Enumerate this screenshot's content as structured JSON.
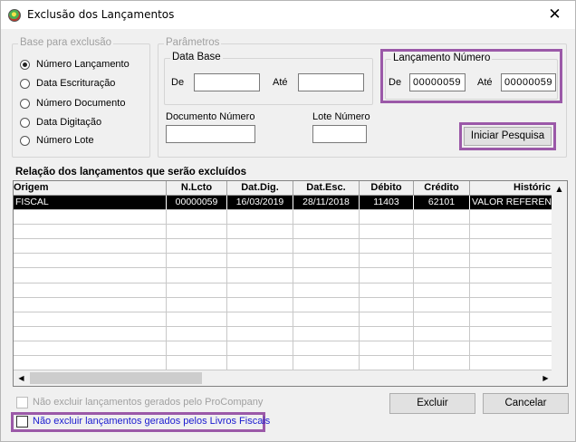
{
  "window": {
    "title": "Exclusão dos Lançamentos",
    "close_glyph": "✕"
  },
  "base": {
    "legend": "Base para exclusão",
    "options": [
      {
        "label": "Número Lançamento",
        "checked": true
      },
      {
        "label": "Data Escrituração",
        "checked": false
      },
      {
        "label": "Número Documento",
        "checked": false
      },
      {
        "label": "Data Digitação",
        "checked": false
      },
      {
        "label": "Número Lote",
        "checked": false
      }
    ]
  },
  "parametros": {
    "legend": "Parâmetros",
    "data_base": {
      "legend": "Data Base",
      "de_label": "De",
      "ate_label": "Até",
      "de_value": "",
      "ate_value": ""
    },
    "lancamento": {
      "legend": "Lançamento Número",
      "de_label": "De",
      "ate_label": "Até",
      "de_value": "00000059",
      "ate_value": "00000059"
    },
    "documento_label": "Documento Número",
    "documento_value": "",
    "lote_label": "Lote Número",
    "lote_value": "",
    "search_button": "Iniciar Pesquisa"
  },
  "list": {
    "title": "Relação dos lançamentos que serão excluídos",
    "columns": [
      "Origem",
      "N.Lcto",
      "Dat.Dig.",
      "Dat.Esc.",
      "Débito",
      "Crédito",
      "Históric"
    ],
    "rows": [
      [
        "FISCAL",
        "00000059",
        "16/03/2019",
        "28/11/2018",
        "11403",
        "62101",
        "VALOR REFERENTE"
      ]
    ],
    "empty_rows": 12
  },
  "footer": {
    "checkbox_procompany": "Não excluir lançamentos gerados pelo ProCompany",
    "checkbox_livros": "Não excluir lançamentos gerados pelos Livros Fiscais",
    "excluir_button": "Excluir",
    "cancelar_button": "Cancelar"
  },
  "colors": {
    "highlight": "#9b59a8",
    "selected_row_bg": "#000000",
    "link_blue": "#1a1ad0"
  }
}
